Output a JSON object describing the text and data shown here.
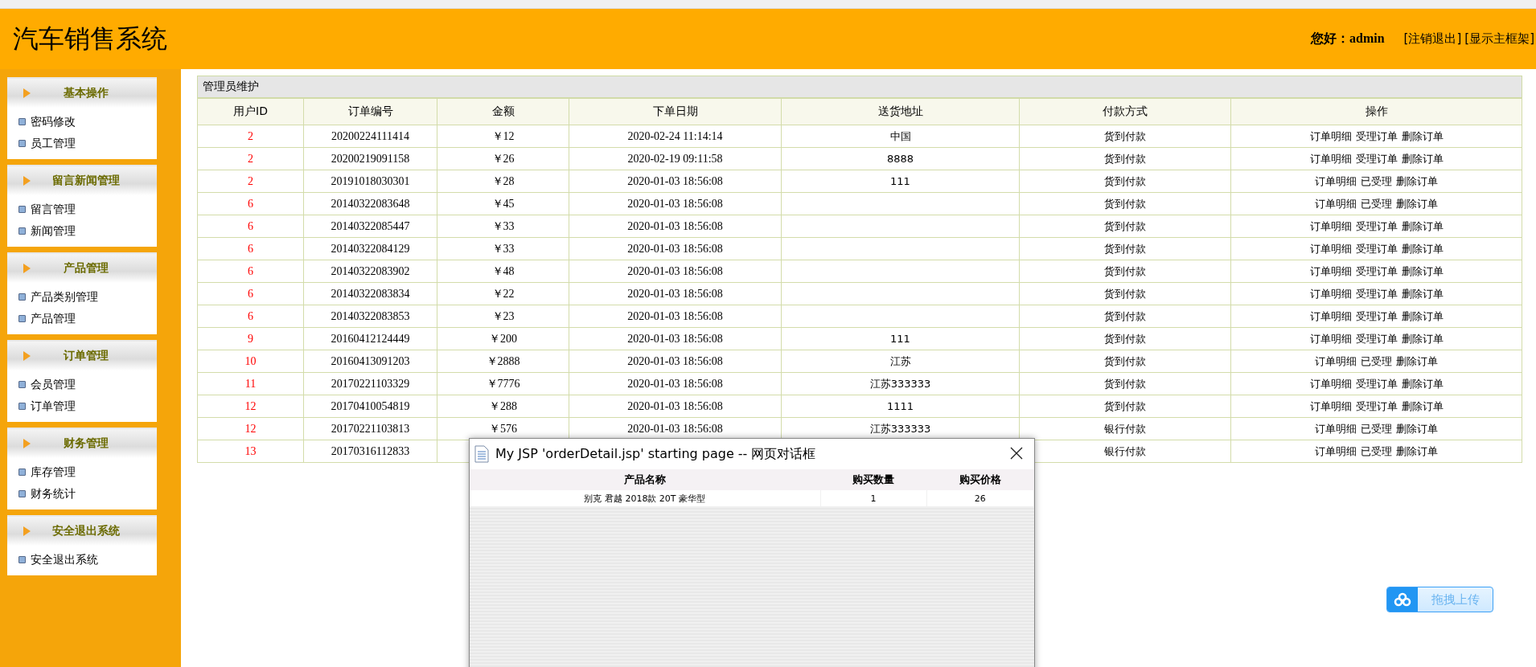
{
  "header": {
    "title": "汽车销售系统",
    "greeting": "您好：admin",
    "links": [
      "[注销退出]",
      "[显示主框架]"
    ]
  },
  "sidebar": [
    {
      "title": "基本操作",
      "items": [
        "密码修改",
        "员工管理"
      ]
    },
    {
      "title": "留言新闻管理",
      "items": [
        "留言管理",
        "新闻管理"
      ]
    },
    {
      "title": "产品管理",
      "items": [
        "产品类别管理",
        "产品管理"
      ]
    },
    {
      "title": "订单管理",
      "items": [
        "会员管理",
        "订单管理"
      ]
    },
    {
      "title": "财务管理",
      "items": [
        "库存管理",
        "财务统计"
      ]
    },
    {
      "title": "安全退出系统",
      "items": [
        "安全退出系统"
      ]
    }
  ],
  "panel": {
    "title": "管理员维护"
  },
  "table": {
    "columns": [
      "用户ID",
      "订单编号",
      "金额",
      "下单日期",
      "送货地址",
      "付款方式",
      "操作"
    ],
    "rows": [
      {
        "user_id": "2",
        "order_no": "20200224111414",
        "amount": "￥12",
        "date": "2020-02-24 11:14:14",
        "address": "中国",
        "payment": "货到付款",
        "actions": [
          "订单明细",
          "受理订单",
          "删除订单"
        ]
      },
      {
        "user_id": "2",
        "order_no": "20200219091158",
        "amount": "￥26",
        "date": "2020-02-19 09:11:58",
        "address": "8888",
        "payment": "货到付款",
        "actions": [
          "订单明细",
          "受理订单",
          "删除订单"
        ]
      },
      {
        "user_id": "2",
        "order_no": "20191018030301",
        "amount": "￥28",
        "date": "2020-01-03 18:56:08",
        "address": "111",
        "payment": "货到付款",
        "actions": [
          "订单明细",
          "已受理",
          "删除订单"
        ]
      },
      {
        "user_id": "6",
        "order_no": "20140322083648",
        "amount": "￥45",
        "date": "2020-01-03 18:56:08",
        "payment": "货到付款",
        "actions": [
          "订单明细",
          "已受理",
          "删除订单"
        ]
      },
      {
        "user_id": "6",
        "order_no": "20140322085447",
        "amount": "￥33",
        "date": "2020-01-03 18:56:08",
        "payment": "货到付款",
        "actions": [
          "订单明细",
          "受理订单",
          "删除订单"
        ]
      },
      {
        "user_id": "6",
        "order_no": "20140322084129",
        "amount": "￥33",
        "date": "2020-01-03 18:56:08",
        "payment": "货到付款",
        "actions": [
          "订单明细",
          "受理订单",
          "删除订单"
        ]
      },
      {
        "user_id": "6",
        "order_no": "20140322083902",
        "amount": "￥48",
        "date": "2020-01-03 18:56:08",
        "payment": "货到付款",
        "actions": [
          "订单明细",
          "受理订单",
          "删除订单"
        ]
      },
      {
        "user_id": "6",
        "order_no": "20140322083834",
        "amount": "￥22",
        "date": "2020-01-03 18:56:08",
        "payment": "货到付款",
        "actions": [
          "订单明细",
          "受理订单",
          "删除订单"
        ]
      },
      {
        "user_id": "6",
        "order_no": "20140322083853",
        "amount": "￥23",
        "date": "2020-01-03 18:56:08",
        "payment": "货到付款",
        "actions": [
          "订单明细",
          "受理订单",
          "删除订单"
        ]
      },
      {
        "user_id": "9",
        "order_no": "20160412124449",
        "amount": "￥200",
        "date": "2020-01-03 18:56:08",
        "address": "111",
        "payment": "货到付款",
        "actions": [
          "订单明细",
          "受理订单",
          "删除订单"
        ]
      },
      {
        "user_id": "10",
        "order_no": "20160413091203",
        "amount": "￥2888",
        "date": "2020-01-03 18:56:08",
        "address": "江苏",
        "payment": "货到付款",
        "actions": [
          "订单明细",
          "已受理",
          "删除订单"
        ]
      },
      {
        "user_id": "11",
        "order_no": "20170221103329",
        "amount": "￥7776",
        "date": "2020-01-03 18:56:08",
        "address": "江苏333333",
        "payment": "货到付款",
        "actions": [
          "订单明细",
          "受理订单",
          "删除订单"
        ]
      },
      {
        "user_id": "12",
        "order_no": "20170410054819",
        "amount": "￥288",
        "date": "2020-01-03 18:56:08",
        "address": "1111",
        "payment": "货到付款",
        "actions": [
          "订单明细",
          "受理订单",
          "删除订单"
        ]
      },
      {
        "user_id": "12",
        "order_no": "20170221103813",
        "amount": "￥576",
        "date": "2020-01-03 18:56:08",
        "address": "江苏333333",
        "payment": "银行付款",
        "actions": [
          "订单明细",
          "已受理",
          "删除订单"
        ]
      },
      {
        "user_id": "13",
        "order_no": "20170316112833",
        "payment": "银行付款",
        "actions": [
          "订单明细",
          "已受理",
          "删除订单"
        ]
      }
    ]
  },
  "dialog": {
    "title": "My JSP 'orderDetail.jsp' starting page -- 网页对话框",
    "columns": [
      "产品名称",
      "购买数量",
      "购买价格"
    ],
    "rows": [
      [
        "别克 君越 2018款 20T 豪华型",
        "1",
        "26"
      ]
    ]
  },
  "upload_button": {
    "label": "拖拽上传"
  }
}
